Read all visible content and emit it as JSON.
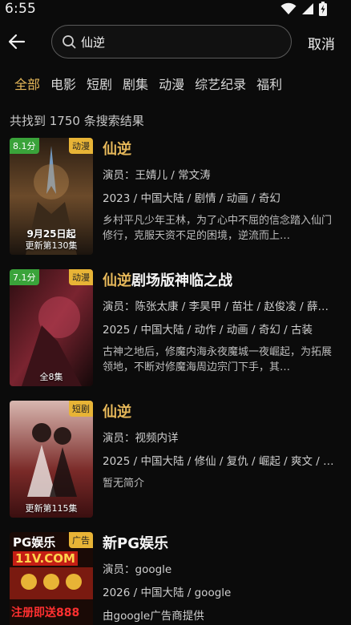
{
  "status": {
    "time": "6:55"
  },
  "search": {
    "query": "仙逆",
    "cancel": "取消"
  },
  "tabs": [
    "全部",
    "电影",
    "短剧",
    "剧集",
    "动漫",
    "综艺纪录",
    "福利"
  ],
  "result_count": "共找到 1750 条搜索结果",
  "results": [
    {
      "title_hl": "仙逆",
      "title_rest": "",
      "score": "8.1分",
      "tag": "动漫",
      "episode": "更新第130集",
      "cast": "演员：王婧儿 / 常文涛",
      "meta": "2023 / 中国大陆 / 剧情 / 动画 / 奇幻",
      "desc": "乡村平凡少年王林，为了心中不屈的信念踏入仙门修行，克服天资不足的困境，逆流而上…",
      "poster_text": "9月25日起"
    },
    {
      "title_hl": "仙逆",
      "title_rest": "剧场版神临之战",
      "score": "7.1分",
      "tag": "动漫",
      "episode": "全8集",
      "cast": "演员：陈张太康 / 李昊甲 / 苗壮 / 赵俊凌 / 薛…",
      "meta": "2025 / 中国大陆 / 动作 / 动画 / 奇幻 / 古装",
      "desc": "古神之地后，修魔内海永夜魔城一夜崛起，为拓展领地，不断对修魔海周边宗门下手，其…"
    },
    {
      "title_hl": "仙逆",
      "title_rest": "",
      "score": "",
      "tag": "短剧",
      "episode": "更新第115集",
      "cast": "演员：视频内详",
      "meta": "2025 / 中国大陆 / 修仙 / 复仇 / 崛起 / 爽文 / …",
      "desc": "暂无简介"
    },
    {
      "title_hl": "",
      "title_rest": "新PG娱乐",
      "score": "",
      "tag": "广告",
      "episode": "",
      "cast": "演员：google",
      "meta": "2026 / 中国大陆 / google",
      "desc": "由google广告商提供",
      "poster_text_1": "PG娱乐",
      "poster_text_2": "11V.COM",
      "poster_text_3": "注册即送888"
    }
  ],
  "colors": {
    "accent": "#e6b85a",
    "score_bg": "#3aa33a",
    "tag_bg": "#e8b436",
    "background": "#0b0b0b"
  }
}
